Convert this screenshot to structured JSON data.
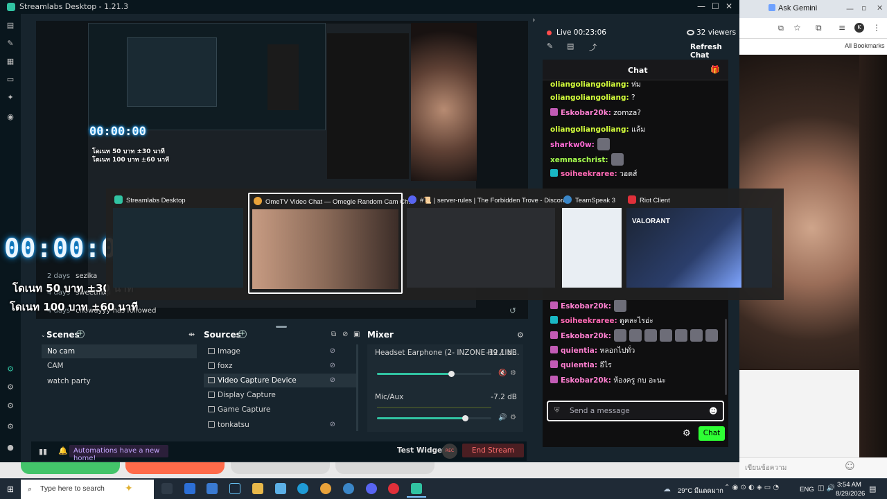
{
  "background_browser": {
    "tab_label": "Ask Gemini",
    "bookmarks_label": "All Bookmarks",
    "bottom_input_placeholder": "เขียนข้อความ"
  },
  "streamlabs": {
    "window_title": "Streamlabs Desktop - 1.21.3",
    "preview": {
      "timer": "00:00:00",
      "donation_lines": [
        "โดเนท 50 บาท ±30 นาที",
        "โดเนท 100 บาท ±60 นาที"
      ],
      "recent_events": [
        {
          "when": "2 days",
          "text": "sezika"
        },
        {
          "when": "4 days",
          "text": "sweetmxji"
        },
        {
          "when": "4 days",
          "text": "chowdyyy  has followed"
        }
      ]
    },
    "alt_tab": {
      "items": [
        {
          "label": "Streamlabs Desktop",
          "icon": "streamlabs-icon",
          "color": "#31c3a2"
        },
        {
          "label": "OmeTV Video Chat — Omegle Random Cam Ch...",
          "icon": "chrome-icon",
          "color": "#e8a23a"
        },
        {
          "label": "#📜 | server-rules | The Forbidden Trove - Discord",
          "icon": "discord-icon",
          "color": "#5865f2"
        },
        {
          "label": "TeamSpeak 3",
          "icon": "teamspeak-icon",
          "color": "#3a86c7"
        },
        {
          "label": "Riot Client",
          "icon": "riot-icon",
          "color": "#e0303a"
        }
      ],
      "valorant_label": "VALORANT"
    },
    "scenes": {
      "title": "Scenes",
      "items": [
        "No cam",
        "CAM",
        "watch party"
      ],
      "active_index": 0
    },
    "sources": {
      "title": "Sources",
      "items": [
        "Image",
        "foxz",
        "Video Capture Device",
        "Display Capture",
        "Game Capture",
        "tonkatsu"
      ],
      "active_index": 2
    },
    "mixer": {
      "title": "Mixer",
      "channels": [
        {
          "name": "Headset Earphone (2- INZONE H9 / IN...",
          "db": "-12.1 dB",
          "level": 0.65
        },
        {
          "name": "Mic/Aux",
          "db": "-7.2 dB",
          "level": 0.77
        }
      ]
    },
    "footer": {
      "automations": "Automations have a new home!",
      "test_widgets": "Test Widgets",
      "rec": "REC",
      "end_stream": "End Stream"
    },
    "live": {
      "status": "Live 00:23:06",
      "viewers": "32 viewers",
      "refresh_chat": "Refresh Chat"
    },
    "chat": {
      "title": "Chat",
      "messages_top": [
        {
          "user": "oliangoliangoliang",
          "text": "ห่ม",
          "color": "#d4ff3b",
          "badge": ""
        },
        {
          "user": "oliangoliangoliang",
          "text": "?",
          "color": "#d4ff3b",
          "badge": ""
        },
        {
          "user": "Eskobar20k",
          "text": "zomza?",
          "color": "#ff7fd0",
          "badge": "#c25bb5"
        },
        {
          "user": "oliangoliangoliang",
          "text": "แล้ม",
          "color": "#d4ff3b",
          "badge": ""
        },
        {
          "user": "sharkw0w",
          "text": "",
          "color": "#ff6ad5",
          "badge": ""
        },
        {
          "user": "xemnaschrist",
          "text": "",
          "color": "#a6ff4d",
          "badge": ""
        },
        {
          "user": "soiheekraree",
          "text": "วอดส์",
          "color": "#ff69b4",
          "badge": "#19b7c4"
        }
      ],
      "messages_bottom": [
        {
          "user": "Eskobar20k",
          "text": "",
          "color": "#ff7fd0",
          "badge": "#c25bb5",
          "emotes": 1
        },
        {
          "user": "soiheekraree",
          "text": "ดูคละไรอ่ะ",
          "color": "#ff69b4",
          "badge": "#19b7c4",
          "emotes": 0
        },
        {
          "user": "Eskobar20k",
          "text": "",
          "color": "#ff7fd0",
          "badge": "#c25bb5",
          "emotes": 7
        },
        {
          "user": "quientia",
          "text": "หลอกไปทั่ว",
          "color": "#ff7fd0",
          "badge": "#c25bb5",
          "emotes": 0
        },
        {
          "user": "quientia",
          "text": "อีไร",
          "color": "#ff7fd0",
          "badge": "#c25bb5",
          "emotes": 0
        },
        {
          "user": "Eskobar20k",
          "text": "ห้องครู กบ อะนะ",
          "color": "#ff7fd0",
          "badge": "#c25bb5",
          "emotes": 0
        }
      ],
      "input_placeholder": "Send a message",
      "chat_button": "Chat"
    }
  },
  "taskbar": {
    "search_placeholder": "Type here to search",
    "weather": "29°C มีแดดมาก",
    "lang": "ENG",
    "time": "3:54 AM",
    "date": "8/29/2026"
  }
}
